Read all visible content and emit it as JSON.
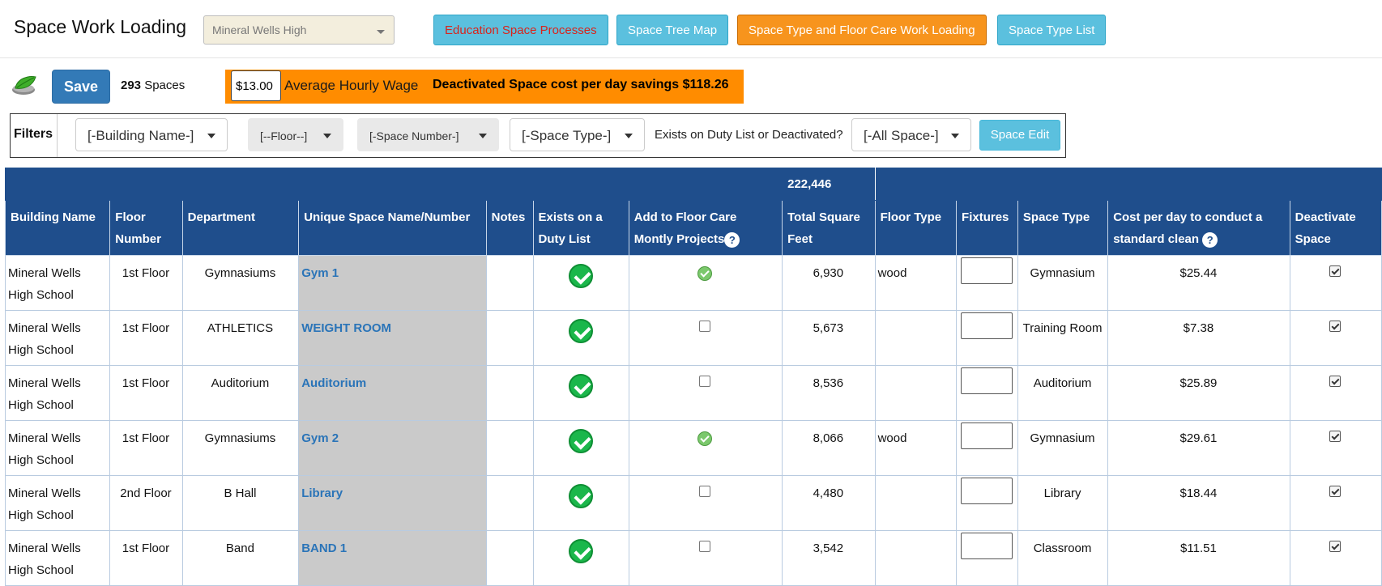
{
  "header": {
    "title": "Space Work Loading",
    "school_select": "Mineral Wells High",
    "buttons": {
      "education": "Education Space Processes",
      "tree_map": "Space Tree Map",
      "type_floor_care": "Space Type and Floor Care Work Loading",
      "type_list": "Space Type List"
    }
  },
  "toolbar": {
    "save_label": "Save",
    "space_count": "293",
    "space_word": "Spaces",
    "wage_value": "$13.00",
    "wage_label": "Average Hourly Wage",
    "savings_text": "Deactivated Space cost per day savings $118.26"
  },
  "filters": {
    "label": "Filters",
    "building": "[-Building Name-]",
    "floor": "[--Floor--]",
    "space_number": "[-Space Number-]",
    "space_type": "[-Space Type-]",
    "exists_label": "Exists on Duty List or Deactivated?",
    "all_space": "[-All Space-]",
    "space_edit": "Space Edit"
  },
  "table": {
    "total_sqft": "222,446",
    "headers": {
      "building": "Building Name",
      "floor": "Floor Number",
      "department": "Department",
      "space": "Unique Space Name/Number",
      "notes": "Notes",
      "exists": "Exists on a Duty List",
      "floorcare": "Add to Floor Care Montly Projects",
      "sqft": "Total Square Feet",
      "floor_type": "Floor Type",
      "fixtures": "Fixtures",
      "space_type": "Space Type",
      "cost": "Cost per day to conduct a standard clean",
      "deactivate": "Deactivate Space"
    },
    "rows": [
      {
        "building": "Mineral Wells High School",
        "floor": "1st Floor",
        "department": "Gymnasiums",
        "space": "Gym 1",
        "floorcare": true,
        "sqft": "6,930",
        "floor_type": "wood",
        "space_type": "Gymnasium",
        "cost": "$25.44"
      },
      {
        "building": "Mineral Wells High School",
        "floor": "1st Floor",
        "department": "ATHLETICS",
        "space": "WEIGHT ROOM",
        "floorcare": false,
        "sqft": "5,673",
        "floor_type": "",
        "space_type": "Training Room",
        "cost": "$7.38"
      },
      {
        "building": "Mineral Wells High School",
        "floor": "1st Floor",
        "department": "Auditorium",
        "space": "Auditorium",
        "floorcare": false,
        "sqft": "8,536",
        "floor_type": "",
        "space_type": "Auditorium",
        "cost": "$25.89"
      },
      {
        "building": "Mineral Wells High School",
        "floor": "1st Floor",
        "department": "Gymnasiums",
        "space": "Gym 2",
        "floorcare": true,
        "sqft": "8,066",
        "floor_type": "wood",
        "space_type": "Gymnasium",
        "cost": "$29.61"
      },
      {
        "building": "Mineral Wells High School",
        "floor": "2nd Floor",
        "department": "B Hall",
        "space": "Library",
        "floorcare": false,
        "sqft": "4,480",
        "floor_type": "",
        "space_type": "Library",
        "cost": "$18.44"
      },
      {
        "building": "Mineral Wells High School",
        "floor": "1st Floor",
        "department": "Band",
        "space": "BAND 1",
        "floorcare": false,
        "sqft": "3,542",
        "floor_type": "",
        "space_type": "Classroom",
        "cost": "$11.51"
      }
    ]
  }
}
